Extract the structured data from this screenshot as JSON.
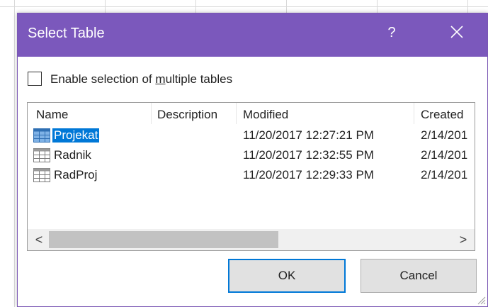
{
  "dialog": {
    "title": "Select Table",
    "help_label": "?",
    "close_icon": "close-icon",
    "multi_select": {
      "label_before": "Enable selection of ",
      "label_underlined": "m",
      "label_after": "ultiple tables",
      "checked": false
    },
    "columns": {
      "name": "Name",
      "description": "Description",
      "modified": "Modified",
      "created": "Created"
    },
    "rows": [
      {
        "name": "Projekat",
        "description": "",
        "modified": "11/20/2017 12:27:21 PM",
        "created": "2/14/201",
        "selected": true,
        "icon": "table-icon"
      },
      {
        "name": "Radnik",
        "description": "",
        "modified": "11/20/2017 12:32:55 PM",
        "created": "2/14/201",
        "selected": false,
        "icon": "table-icon"
      },
      {
        "name": "RadProj",
        "description": "",
        "modified": "11/20/2017 12:29:33 PM",
        "created": "2/14/201",
        "selected": false,
        "icon": "table-icon"
      }
    ],
    "scroll_left_label": "<",
    "scroll_right_label": ">",
    "ok_label": "OK",
    "cancel_label": "Cancel",
    "colors": {
      "titlebar": "#7b58bc",
      "selection": "#0078d7",
      "ok_border": "#0078d7"
    }
  }
}
